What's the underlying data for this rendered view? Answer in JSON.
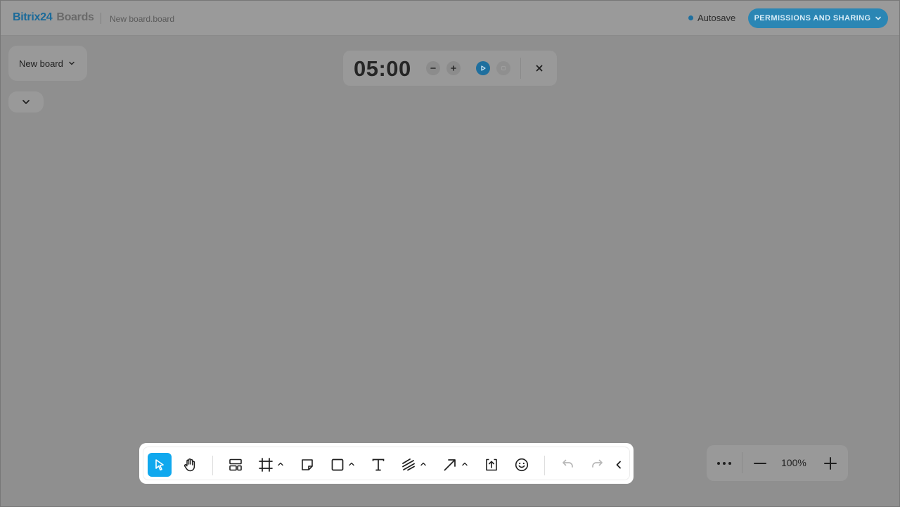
{
  "header": {
    "brand": "Bitrix",
    "brand_num": "24",
    "product": "Boards",
    "filename": "New board.board",
    "autosave_label": "Autosave",
    "permissions_label": "PERMISSIONS AND SHARING"
  },
  "board_select": {
    "label": "New board"
  },
  "timer": {
    "time": "05:00"
  },
  "zoom": {
    "level": "100%"
  },
  "colors": {
    "accent": "#10a8ee",
    "brand": "#1b6a99",
    "overlay": "#8f8f8f"
  },
  "toolbar": {
    "tools": [
      "select-tool",
      "hand-tool",
      "template-tool",
      "frame-tool",
      "sticky-note-tool",
      "shape-tool",
      "text-tool",
      "pen-tool",
      "arrow-tool",
      "upload-tool",
      "emoji-tool",
      "undo",
      "redo",
      "collapse-toolbar"
    ]
  }
}
